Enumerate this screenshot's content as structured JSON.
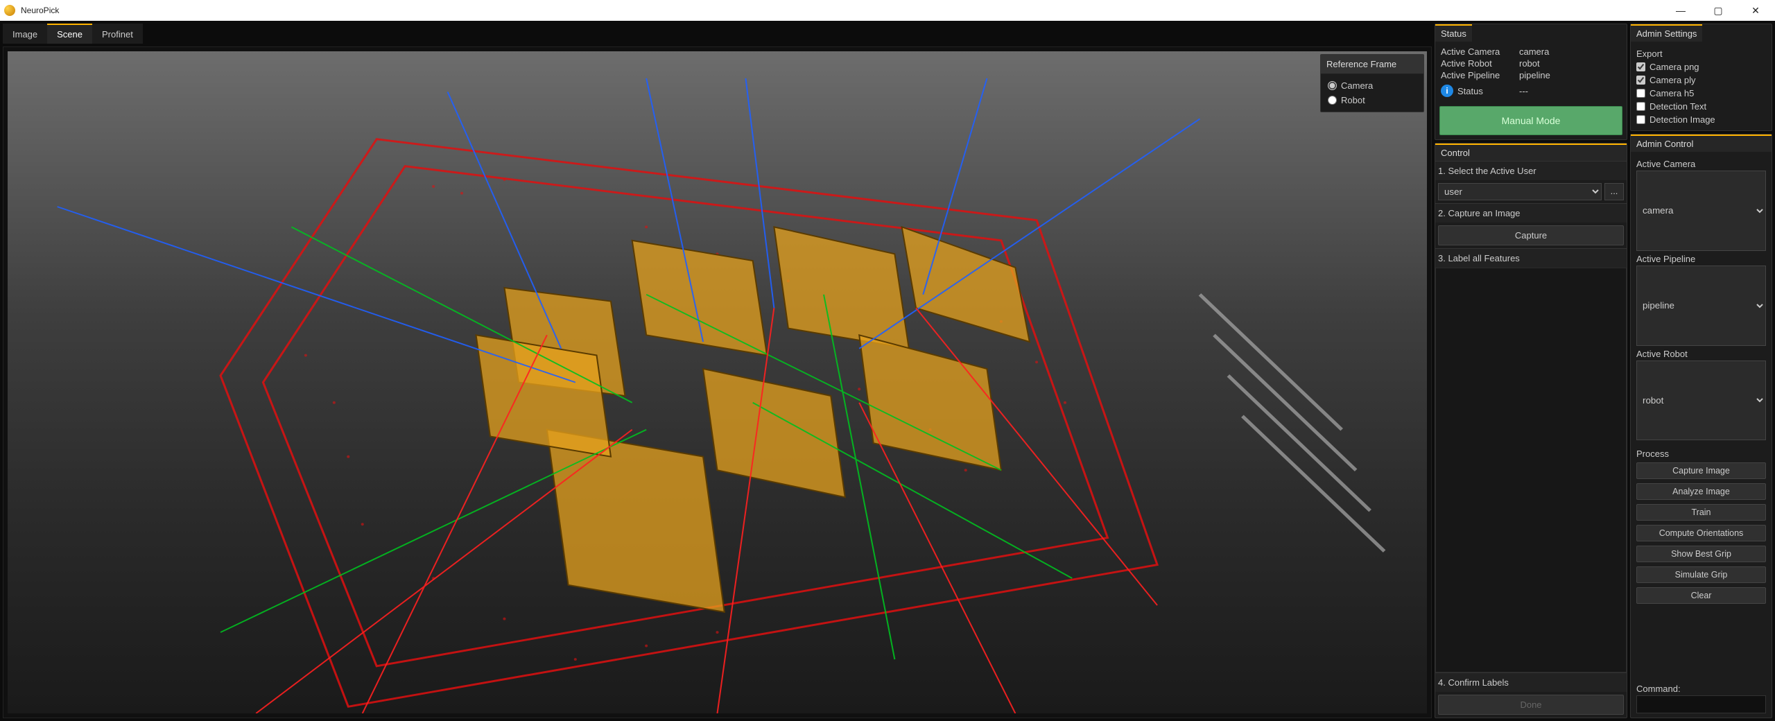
{
  "app": {
    "title": "NeuroPick"
  },
  "window_controls": {
    "min": "—",
    "max": "▢",
    "close": "✕"
  },
  "tabs": {
    "image": "Image",
    "scene": "Scene",
    "profinet": "Profinet"
  },
  "reference_frame": {
    "header": "Reference Frame",
    "camera": "Camera",
    "robot": "Robot"
  },
  "status": {
    "header": "Status",
    "rows": {
      "active_camera_k": "Active Camera",
      "active_camera_v": "camera",
      "active_robot_k": "Active Robot",
      "active_robot_v": "robot",
      "active_pipeline_k": "Active Pipeline",
      "active_pipeline_v": "pipeline",
      "status_k": "Status",
      "status_v": "---"
    },
    "mode_button": "Manual Mode"
  },
  "control": {
    "header": "Control",
    "step1": "1. Select the Active User",
    "user_option": "user",
    "ellipsis": "...",
    "step2": "2. Capture an Image",
    "capture_btn": "Capture",
    "step3": "3. Label all Features",
    "step4": "4. Confirm Labels",
    "done_btn": "Done"
  },
  "admin_settings": {
    "header": "Admin Settings",
    "export_label": "Export",
    "checks": {
      "camera_png": "Camera png",
      "camera_ply": "Camera ply",
      "camera_h5": "Camera h5",
      "detection_text": "Detection Text",
      "detection_image": "Detection Image"
    }
  },
  "admin_control": {
    "header": "Admin Control",
    "active_camera_label": "Active Camera",
    "active_camera_value": "camera",
    "active_pipeline_label": "Active Pipeline",
    "active_pipeline_value": "pipeline",
    "active_robot_label": "Active Robot",
    "active_robot_value": "robot",
    "process_label": "Process",
    "buttons": {
      "capture_image": "Capture Image",
      "analyze_image": "Analyze Image",
      "train": "Train",
      "compute_orientations": "Compute Orientations",
      "show_best_grip": "Show Best Grip",
      "simulate_grip": "Simulate Grip",
      "clear": "Clear"
    },
    "command_label": "Command:"
  }
}
